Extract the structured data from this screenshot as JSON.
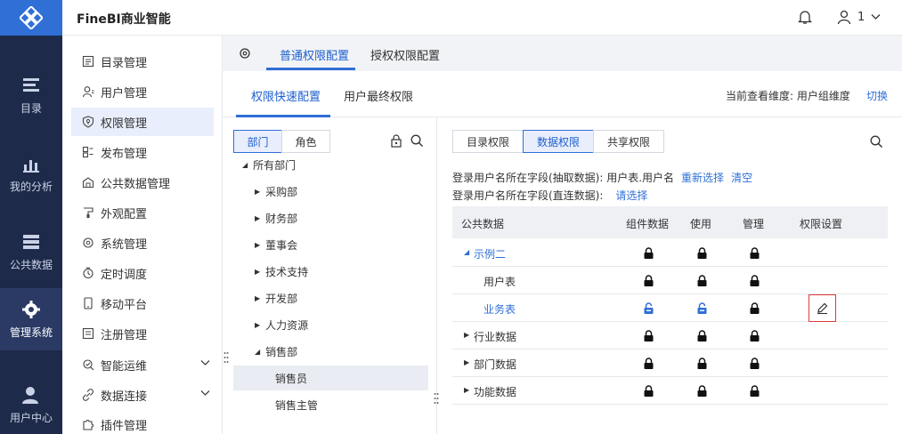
{
  "app": {
    "title": "FineBI商业智能",
    "user": "1"
  },
  "rail": [
    {
      "label": "目录",
      "icon": "catalog-icon"
    },
    {
      "label": "我的分析",
      "icon": "analysis-icon"
    },
    {
      "label": "公共数据",
      "icon": "public-data-icon"
    },
    {
      "label": "管理系统",
      "icon": "gear-icon",
      "active": true
    },
    {
      "label": "用户中心",
      "icon": "user-center-icon"
    }
  ],
  "menu": [
    {
      "label": "目录管理",
      "icon": "directory-icon"
    },
    {
      "label": "用户管理",
      "icon": "user-icon"
    },
    {
      "label": "权限管理",
      "icon": "permission-icon",
      "active": true
    },
    {
      "label": "发布管理",
      "icon": "publish-icon"
    },
    {
      "label": "公共数据管理",
      "icon": "public-data-manage-icon"
    },
    {
      "label": "外观配置",
      "icon": "appearance-icon"
    },
    {
      "label": "系统管理",
      "icon": "system-icon"
    },
    {
      "label": "定时调度",
      "icon": "clock-icon"
    },
    {
      "label": "移动平台",
      "icon": "mobile-icon"
    },
    {
      "label": "注册管理",
      "icon": "register-icon"
    },
    {
      "label": "智能运维",
      "icon": "ops-icon",
      "expandable": true
    },
    {
      "label": "数据连接",
      "icon": "link-icon",
      "expandable": true
    },
    {
      "label": "插件管理",
      "icon": "plugin-icon"
    }
  ],
  "tabs": [
    {
      "label": "普通权限配置",
      "active": true
    },
    {
      "label": "授权权限配置"
    }
  ],
  "subtabs": [
    {
      "label": "权限快速配置",
      "active": true
    },
    {
      "label": "用户最终权限"
    }
  ],
  "dimension": {
    "label": "当前查看维度: 用户组维度",
    "switch": "切换"
  },
  "left_seg": [
    {
      "label": "部门",
      "active": true
    },
    {
      "label": "角色"
    }
  ],
  "tree": [
    {
      "label": "所有部门",
      "level": 0,
      "expanded": true
    },
    {
      "label": "采购部",
      "level": 1
    },
    {
      "label": "财务部",
      "level": 1
    },
    {
      "label": "董事会",
      "level": 1
    },
    {
      "label": "技术支持",
      "level": 1
    },
    {
      "label": "开发部",
      "level": 1
    },
    {
      "label": "人力资源",
      "level": 1
    },
    {
      "label": "销售部",
      "level": 1,
      "expanded": true
    },
    {
      "label": "销售员",
      "level": 2,
      "selected": true
    },
    {
      "label": "销售主管",
      "level": 2
    }
  ],
  "right_seg": [
    {
      "label": "目录权限"
    },
    {
      "label": "数据权限",
      "active": true
    },
    {
      "label": "共享权限"
    }
  ],
  "info": {
    "line1": "登录用户名所在字段(抽取数据): 用户表.用户名",
    "reselect": "重新选择",
    "clear": "清空",
    "line2": "登录用户名所在字段(直连数据):",
    "select": "请选择"
  },
  "table": {
    "headers": [
      "公共数据",
      "组件数据",
      "使用",
      "管理",
      "权限设置"
    ],
    "rows": [
      {
        "name": "示例二",
        "level": 0,
        "expanded": true,
        "blue": true,
        "locks": [
          "locked",
          "locked",
          "locked"
        ],
        "edit": false
      },
      {
        "name": "用户表",
        "level": 1,
        "blue": false,
        "locks": [
          "locked",
          "locked",
          "locked"
        ],
        "edit": false
      },
      {
        "name": "业务表",
        "level": 1,
        "blue": true,
        "locks": [
          "unlocked",
          "unlocked",
          "locked"
        ],
        "edit": true
      },
      {
        "name": "行业数据",
        "level": 0,
        "collapsed": true,
        "locks": [
          "locked",
          "locked",
          "locked"
        ],
        "edit": false
      },
      {
        "name": "部门数据",
        "level": 0,
        "collapsed": true,
        "locks": [
          "locked",
          "locked",
          "locked"
        ],
        "edit": false
      },
      {
        "name": "功能数据",
        "level": 0,
        "collapsed": true,
        "locks": [
          "locked",
          "locked",
          "locked"
        ],
        "edit": false
      }
    ]
  },
  "colors": {
    "accent": "#2f6fd6",
    "rail": "#1e2a4a",
    "highlight": "#e03a3a"
  }
}
